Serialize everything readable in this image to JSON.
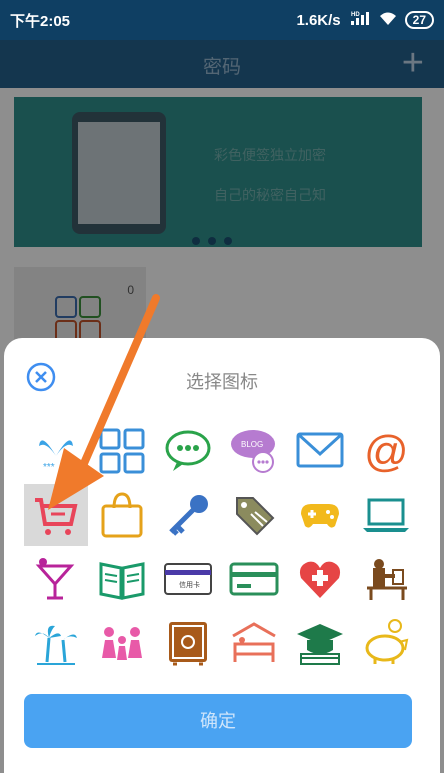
{
  "status": {
    "time": "下午2:05",
    "net_speed": "1.6K/s",
    "signal_label": "HD",
    "battery": "27"
  },
  "appbar": {
    "title": "密码"
  },
  "banner": {
    "line1": "彩色便签独立加密",
    "line2": "自己的秘密自己知"
  },
  "note": {
    "count": "0"
  },
  "dialog": {
    "title": "选择图标",
    "confirm_label": "确定",
    "icons": [
      "bird-icon",
      "grid-icon",
      "chat-icon",
      "blog-icon",
      "mail-icon",
      "at-icon",
      "cart-icon",
      "bag-icon",
      "key-icon",
      "tag-icon",
      "gamepad-icon",
      "laptop-icon",
      "drink-icon",
      "book-icon",
      "card-icon",
      "wallet-card-icon",
      "medical-heart-icon",
      "desk-worker-icon",
      "palm-icon",
      "family-icon",
      "safe-icon",
      "bed-icon",
      "graduation-icon",
      "piggy-bank-icon"
    ],
    "selected_icon": "cart-icon",
    "blog_text": "BLOG",
    "card_text": "信用卡",
    "bird_text": "***"
  },
  "colors": {
    "accent": "#4aa3f2",
    "cart": "#e8455a",
    "arrow": "#f07a2b"
  }
}
